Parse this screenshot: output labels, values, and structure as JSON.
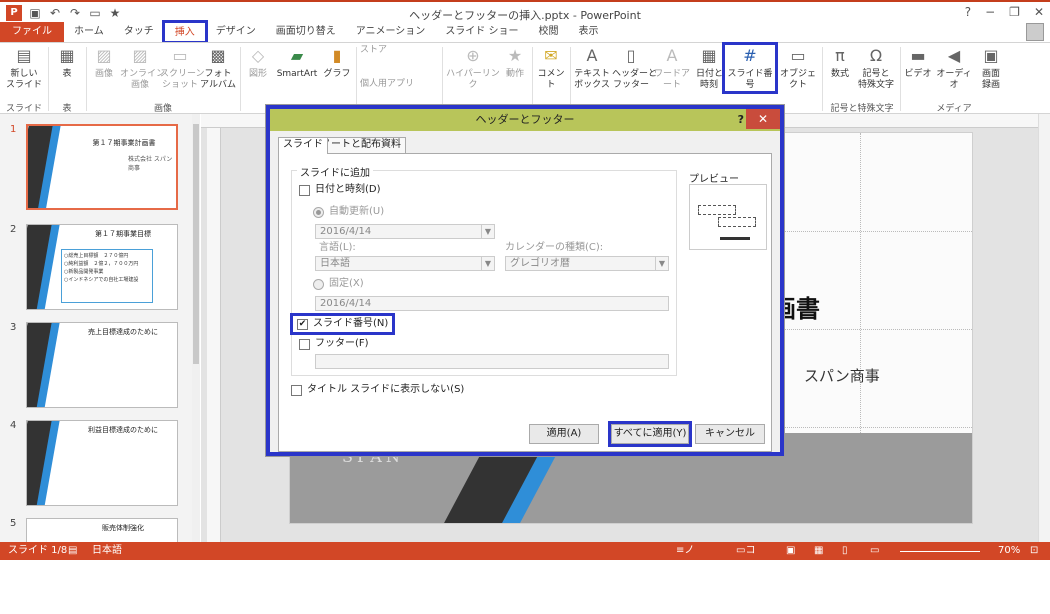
{
  "app": {
    "title": "ヘッダーとフッターの挿入.pptx - PowerPoint",
    "logo": "P",
    "win_min": "?",
    "win_restore": "−",
    "win_max": "❐",
    "win_close": "✕"
  },
  "tabs": [
    "ファイル",
    "ホーム",
    "タッチ",
    "挿入",
    "デザイン",
    "画面切り替え",
    "アニメーション",
    "スライド ショー",
    "校閲",
    "表示"
  ],
  "ribbon": {
    "buttons": [
      {
        "label": "新しい\nスライド"
      },
      {
        "label": "表"
      },
      {
        "label": "画像"
      },
      {
        "label": "オンライン\n画像"
      },
      {
        "label": "スクリーン\nショット"
      },
      {
        "label": "フォト\nアルバム"
      },
      {
        "label": "図形"
      },
      {
        "label": "SmartArt"
      },
      {
        "label": "グラフ"
      },
      {
        "label": "ストア"
      },
      {
        "label": "個人用アプリ"
      },
      {
        "label": "ハイパーリンク"
      },
      {
        "label": "動作"
      },
      {
        "label": "コメント"
      },
      {
        "label": "テキスト\nボックス"
      },
      {
        "label": "ヘッダーと\nフッター"
      },
      {
        "label": "ワードアート"
      },
      {
        "label": "日付と\n時刻"
      },
      {
        "label": "スライド番号"
      },
      {
        "label": "オブジェクト"
      },
      {
        "label": "数式"
      },
      {
        "label": "記号と\n特殊文字"
      },
      {
        "label": "ビデオ"
      },
      {
        "label": "オーディオ"
      },
      {
        "label": "画面\n録画"
      }
    ],
    "groups": [
      "スライド",
      "表",
      "画像",
      "記号と特殊文字",
      "メディア"
    ]
  },
  "slides": [
    {
      "num": "1",
      "title": "第１７期事業計画書",
      "sub": "株式会社 スパン商事"
    },
    {
      "num": "2",
      "title": "第１７期事業目標",
      "lines": [
        "○総売上目標額　２７０億円",
        "○純利益額　２億２，７００万円",
        "○新製品開発事業",
        "○インドネシアでの自社工場建設"
      ]
    },
    {
      "num": "3",
      "title": "売上目標達成のために"
    },
    {
      "num": "4",
      "title": "利益目標達成のために"
    },
    {
      "num": "5",
      "title": "販売体制強化"
    }
  ],
  "slide_canvas": {
    "title": "画書",
    "company": "スパン商事",
    "logo": "SPAN"
  },
  "dialog": {
    "title": "ヘッダーとフッター",
    "help": "?",
    "close": "✕",
    "tabs": [
      "スライド",
      "ノートと配布資料"
    ],
    "group_label": "スライドに追加",
    "date_time": "日付と時刻(D)",
    "auto_update": "自動更新(U)",
    "auto_value": "2016/4/14",
    "language_label": "言語(L):",
    "language_value": "日本語",
    "calendar_label": "カレンダーの種類(C):",
    "calendar_value": "グレゴリオ暦",
    "fixed": "固定(X)",
    "fixed_value": "2016/4/14",
    "slide_number": "スライド番号(N)",
    "footer": "フッター(F)",
    "dont_show_title": "タイトル スライドに表示しない(S)",
    "preview": "プレビュー",
    "apply": "適用(A)",
    "apply_all": "すべてに適用(Y)",
    "cancel": "キャンセル"
  },
  "status": {
    "slide": "スライド 1/8",
    "lang": "日本語",
    "notes": "ノート",
    "comments": "コメント",
    "zoom": "70%"
  }
}
